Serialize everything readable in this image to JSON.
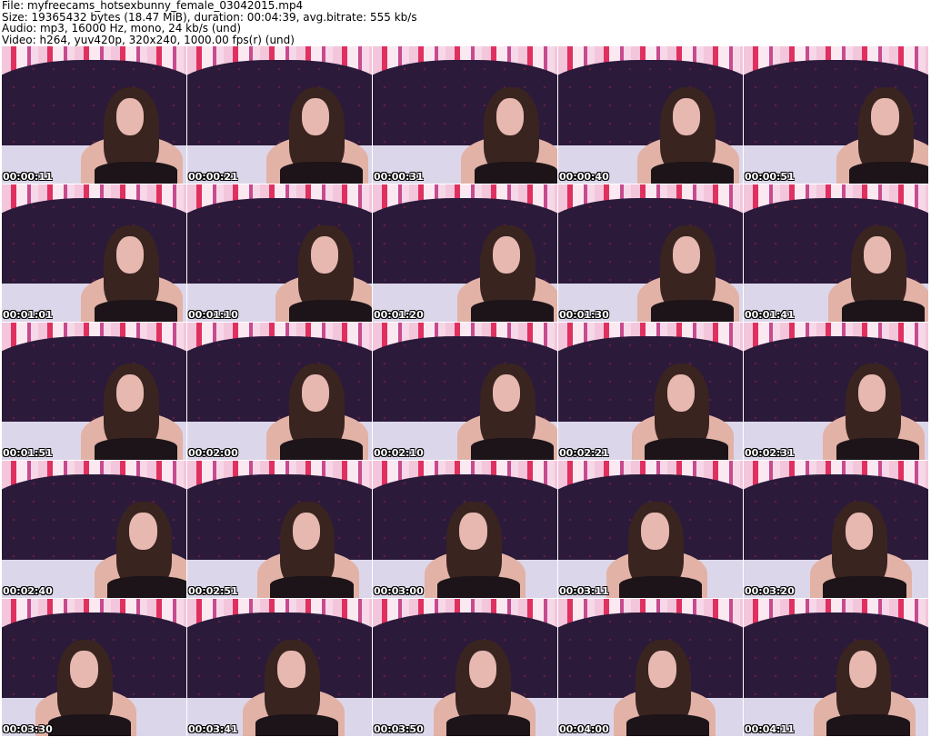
{
  "header": {
    "file": "File: myfreecams_hotsexbunny_female_03042015.mp4",
    "size": "Size: 19365432 bytes (18.47 MiB), duration: 00:04:39, avg.bitrate: 555 kb/s",
    "audio": "Audio: mp3, 16000 Hz, mono, 24 kb/s (und)",
    "video": "Video: h264, yuv420p, 320x240, 1000.00 fps(r) (und)"
  },
  "thumbnails": [
    "00:00:11",
    "00:00:21",
    "00:00:31",
    "00:00:40",
    "00:00:51",
    "00:01:01",
    "00:01:10",
    "00:01:20",
    "00:01:30",
    "00:01:41",
    "00:01:51",
    "00:02:00",
    "00:02:10",
    "00:02:21",
    "00:02:31",
    "00:02:40",
    "00:02:51",
    "00:03:00",
    "00:03:11",
    "00:03:20",
    "00:03:30",
    "00:03:41",
    "00:03:50",
    "00:04:00",
    "00:04:11"
  ]
}
